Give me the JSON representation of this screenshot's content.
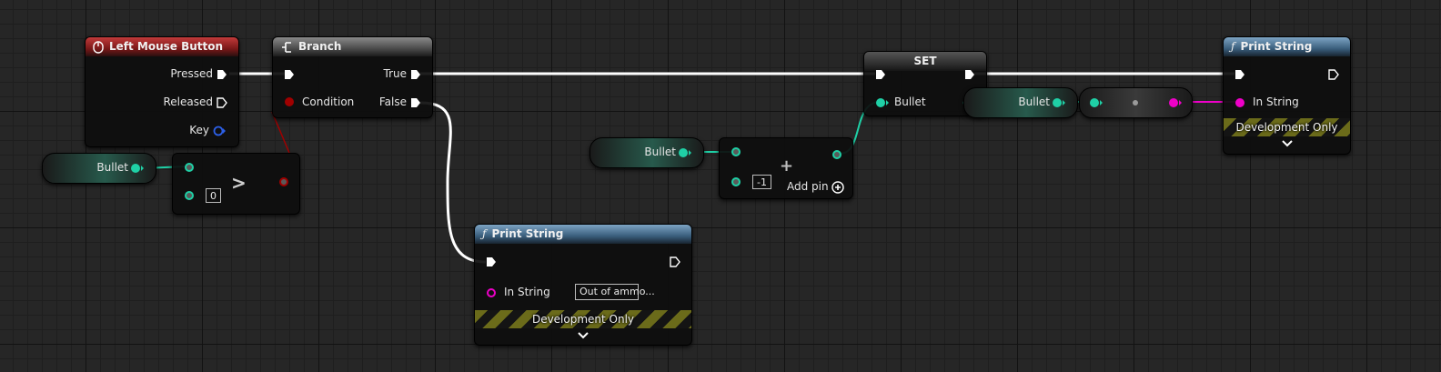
{
  "colors": {
    "exec_wire": "#ffffff",
    "int_wire": "#1fd0a6",
    "string_wire": "#ee00c8",
    "bool_wire": "#a00000",
    "key_pin": "#2c5fe6",
    "event_header": "#9b2020",
    "function_header": "#3f6688",
    "hazard_stripe": "#6b6b1a"
  },
  "graph": {
    "left_mouse_button": {
      "title": "Left Mouse Button",
      "icon": "mouse-icon",
      "pins": {
        "pressed": "Pressed",
        "released": "Released",
        "key": "Key"
      }
    },
    "branch": {
      "title": "Branch",
      "icon": "branch-icon",
      "pins": {
        "condition": "Condition",
        "true": "True",
        "false": "False"
      }
    },
    "bullet_get_1": {
      "label": "Bullet"
    },
    "greater": {
      "operator": ">",
      "value": "0"
    },
    "print_string_false": {
      "title": "Print String",
      "icon": "function-icon",
      "in_string_label": "In String",
      "in_string_value": "Out of ammo...",
      "dev_only": "Development Only"
    },
    "bullet_get_2": {
      "label": "Bullet"
    },
    "add": {
      "operator": "+",
      "value": "-1",
      "add_pin": "Add pin"
    },
    "set": {
      "title": "SET",
      "pin_label": "Bullet"
    },
    "bullet_get_3": {
      "label": "Bullet"
    },
    "print_string_true": {
      "title": "Print String",
      "icon": "function-icon",
      "in_string_label": "In String",
      "dev_only": "Development Only"
    }
  }
}
